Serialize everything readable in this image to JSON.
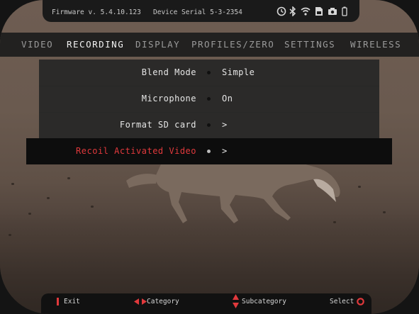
{
  "status": {
    "firmware_text": "Firmware v. 5.4.10.123",
    "serial_text": "Device Serial 5-3-2354",
    "icons": [
      "timer-icon",
      "bluetooth-icon",
      "wifi-icon",
      "sd-card-icon",
      "camera-icon",
      "battery-icon"
    ]
  },
  "tabs": [
    {
      "label": "VIDEO"
    },
    {
      "label": "RECORDING"
    },
    {
      "label": "DISPLAY"
    },
    {
      "label": "PROFILES/ZERO"
    },
    {
      "label": "SETTINGS"
    },
    {
      "label": "WIRELESS"
    }
  ],
  "active_tab": "RECORDING",
  "menu": {
    "items": [
      {
        "label": "Blend Mode",
        "value": "Simple"
      },
      {
        "label": "Microphone",
        "value": "On"
      },
      {
        "label": "Format SD card",
        "value": ">"
      },
      {
        "label": "Recoil Activated Video",
        "value": ">"
      }
    ],
    "selected_index": 3
  },
  "footer": {
    "exit_label": "Exit",
    "category_label": "Category",
    "subcategory_label": "Subcategory",
    "select_label": "Select"
  },
  "colors": {
    "accent_red": "#e1393c",
    "panel_dark": "#262626",
    "text_light": "#e6e6e6"
  }
}
